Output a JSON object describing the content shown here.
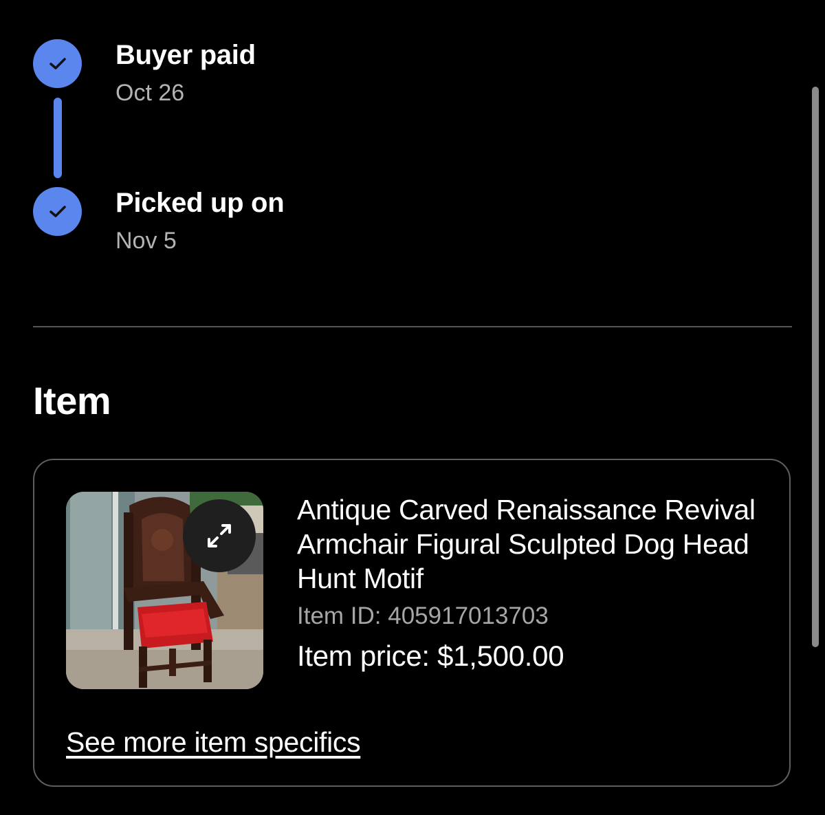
{
  "timeline": {
    "steps": [
      {
        "title": "Buyer paid",
        "date": "Oct 26",
        "icon": "check-icon",
        "status": "complete"
      },
      {
        "title": "Picked up on",
        "date": "Nov 5",
        "icon": "check-icon",
        "status": "complete"
      }
    ],
    "accent_color": "#5a86ee"
  },
  "item_section": {
    "heading": "Item",
    "card": {
      "title": "Antique Carved Renaissance Revival Armchair Figural Sculpted Dog Head Hunt Motif",
      "item_id": "Item ID: 405917013703",
      "price": "Item price: $1,500.00",
      "expand_icon": "expand-icon",
      "see_more_label": "See more item specifics"
    }
  }
}
